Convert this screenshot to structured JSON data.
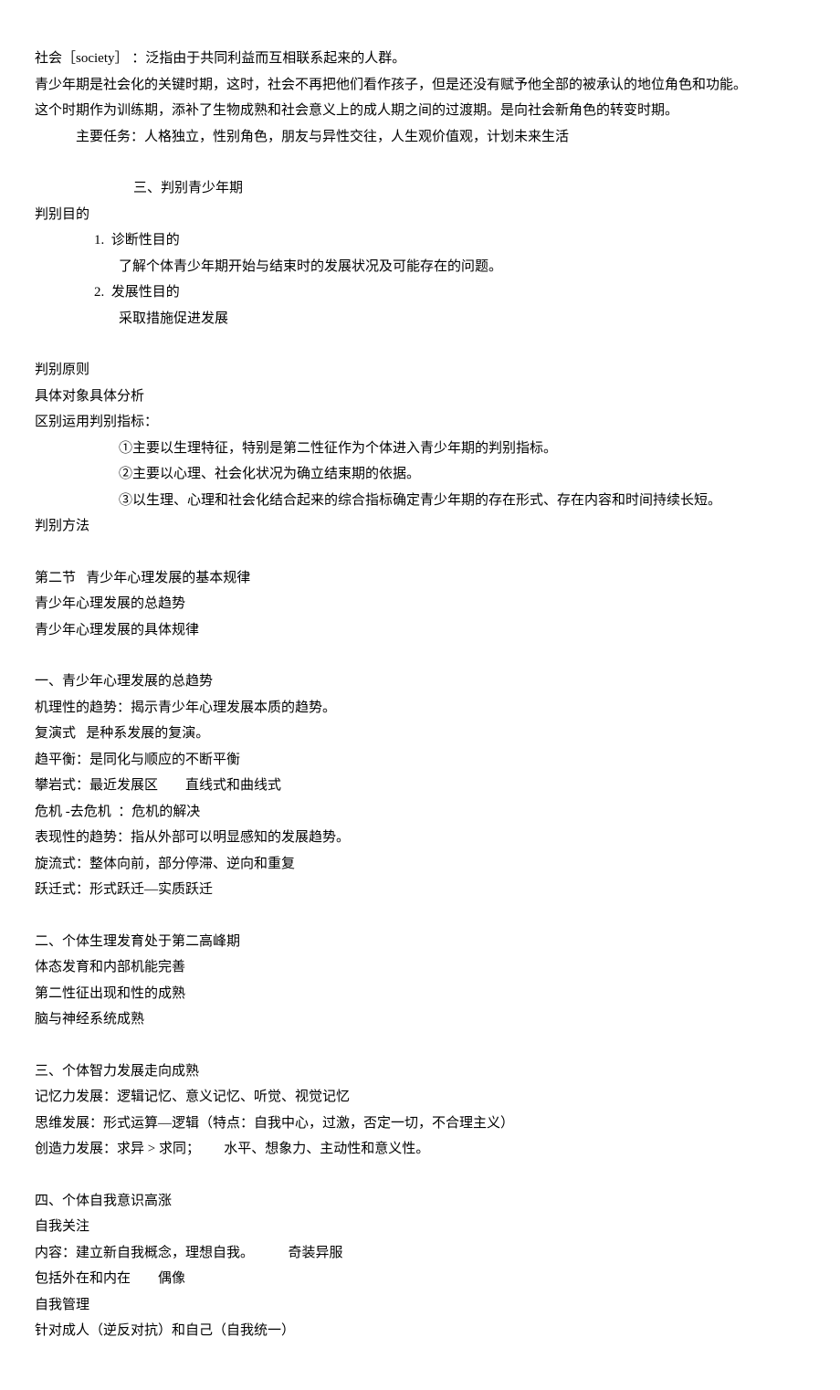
{
  "lines": [
    {
      "cls": "",
      "text": "社会［society］ ：泛指由于共同利益而互相联系起来的人群。"
    },
    {
      "cls": "",
      "text": "青少年期是社会化的关键时期，这时，社会不再把他们看作孩子，但是还没有赋予他全部的被承认的地位角色和功能。"
    },
    {
      "cls": "",
      "text": "这个时期作为训练期，添补了生物成熟和社会意义上的成人期之间的过渡期。是向社会新角色的转变时期。"
    },
    {
      "cls": "indent-1",
      "text": "主要任务：人格独立，性别角色，朋友与异性交往，人生观价值观，计划未来生活"
    },
    {
      "cls": "blank",
      "text": ""
    },
    {
      "cls": "indent-4",
      "text": "三、判别青少年期"
    },
    {
      "cls": "",
      "text": "判别目的"
    },
    {
      "cls": "indent-2",
      "text": "1.  诊断性目的"
    },
    {
      "cls": "indent-3",
      "text": "了解个体青少年期开始与结束时的发展状况及可能存在的问题。"
    },
    {
      "cls": "indent-2",
      "text": "2.  发展性目的"
    },
    {
      "cls": "indent-3",
      "text": "采取措施促进发展"
    },
    {
      "cls": "blank",
      "text": ""
    },
    {
      "cls": "",
      "text": "判别原则"
    },
    {
      "cls": "",
      "text": "具体对象具体分析"
    },
    {
      "cls": "",
      "text": "区别运用判别指标："
    },
    {
      "cls": "indent-3",
      "text": "①主要以生理特征，特别是第二性征作为个体进入青少年期的判别指标。"
    },
    {
      "cls": "indent-3",
      "text": "②主要以心理、社会化状况为确立结束期的依据。"
    },
    {
      "cls": "indent-3",
      "text": "③以生理、心理和社会化结合起来的综合指标确定青少年期的存在形式、存在内容和时间持续长短。"
    },
    {
      "cls": "",
      "text": "判别方法"
    },
    {
      "cls": "blank",
      "text": ""
    },
    {
      "cls": "",
      "text": "第二节   青少年心理发展的基本规律"
    },
    {
      "cls": "",
      "text": "青少年心理发展的总趋势"
    },
    {
      "cls": "",
      "text": "青少年心理发展的具体规律"
    },
    {
      "cls": "blank",
      "text": ""
    },
    {
      "cls": "",
      "text": "一、青少年心理发展的总趋势"
    },
    {
      "cls": "",
      "text": "机理性的趋势：揭示青少年心理发展本质的趋势。"
    },
    {
      "cls": "",
      "text": "复演式   是种系发展的复演。"
    },
    {
      "cls": "",
      "text": "趋平衡：是同化与顺应的不断平衡"
    },
    {
      "cls": "",
      "text": "攀岩式：最近发展区        直线式和曲线式"
    },
    {
      "cls": "",
      "text": "危机 -去危机  ：危机的解决"
    },
    {
      "cls": "",
      "text": "表现性的趋势：指从外部可以明显感知的发展趋势。"
    },
    {
      "cls": "",
      "text": "旋流式：整体向前，部分停滞、逆向和重复"
    },
    {
      "cls": "",
      "text": "跃迁式：形式跃迁—实质跃迁"
    },
    {
      "cls": "blank",
      "text": ""
    },
    {
      "cls": "",
      "text": "二、个体生理发育处于第二高峰期"
    },
    {
      "cls": "",
      "text": "体态发育和内部机能完善"
    },
    {
      "cls": "",
      "text": "第二性征出现和性的成熟"
    },
    {
      "cls": "",
      "text": "脑与神经系统成熟"
    },
    {
      "cls": "blank",
      "text": ""
    },
    {
      "cls": "",
      "text": "三、个体智力发展走向成熟"
    },
    {
      "cls": "",
      "text": "记忆力发展：逻辑记忆、意义记忆、听觉、视觉记忆"
    },
    {
      "cls": "",
      "text": "思维发展：形式运算—逻辑（特点：自我中心，过激，否定一切，不合理主义）"
    },
    {
      "cls": "",
      "text": "创造力发展：求异 > 求同；       水平、想象力、主动性和意义性。"
    },
    {
      "cls": "blank",
      "text": ""
    },
    {
      "cls": "",
      "text": "四、个体自我意识高涨"
    },
    {
      "cls": "",
      "text": "自我关注"
    },
    {
      "cls": "",
      "text": "内容：建立新自我概念，理想自我。          奇装异服"
    },
    {
      "cls": "",
      "text": "包括外在和内在        偶像"
    },
    {
      "cls": "",
      "text": "自我管理"
    },
    {
      "cls": "",
      "text": "针对成人（逆反对抗）和自己（自我统一）"
    }
  ]
}
